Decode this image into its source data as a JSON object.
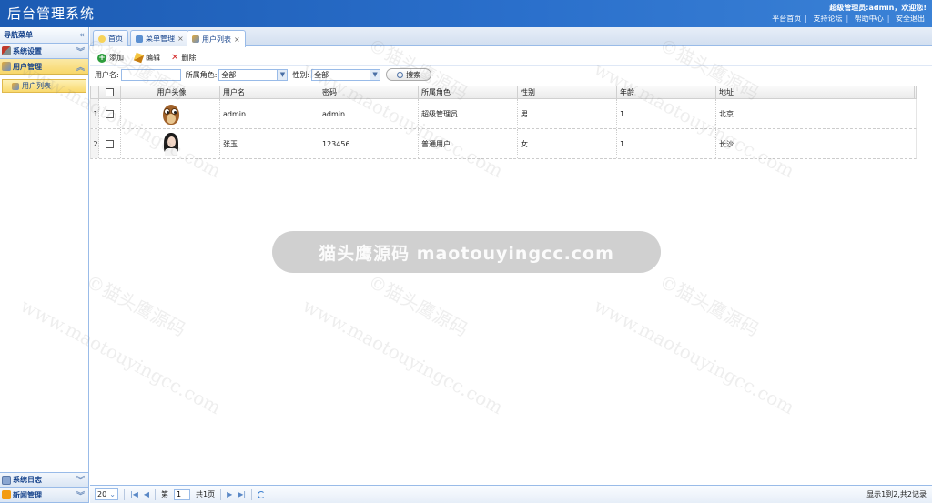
{
  "header": {
    "title": "后台管理系统",
    "welcome": "超级管理员:admin，欢迎您!",
    "links": [
      "平台首页",
      "支持论坛",
      "帮助中心",
      "安全退出"
    ]
  },
  "nav": {
    "title": "导航菜单",
    "panels": [
      {
        "label": "系统设置",
        "icon": "tools-icon"
      },
      {
        "label": "用户管理",
        "icon": "users-icon"
      }
    ],
    "sub_items": [
      {
        "label": "用户列表"
      }
    ],
    "bottom_panels": [
      {
        "label": "系统日志",
        "icon": "log-icon"
      },
      {
        "label": "新闻管理",
        "icon": "rss-icon"
      }
    ]
  },
  "tabs": [
    {
      "label": "首页",
      "closable": false
    },
    {
      "label": "菜单管理",
      "closable": true
    },
    {
      "label": "用户列表",
      "closable": true
    }
  ],
  "toolbar": {
    "add_label": "添加",
    "edit_label": "编辑",
    "delete_label": "删除"
  },
  "search": {
    "username_label": "用户名:",
    "username_value": "",
    "role_label": "所属角色:",
    "role_value": "全部",
    "gender_label": "性别:",
    "gender_value": "全部",
    "button_label": "搜索"
  },
  "table": {
    "columns": [
      "用户头像",
      "用户名",
      "密码",
      "所属角色",
      "性别",
      "年龄",
      "地址"
    ],
    "rows": [
      {
        "num": "1",
        "avatar": "owl-avatar",
        "username": "admin",
        "password": "admin",
        "role": "超级管理员",
        "gender": "男",
        "age": "1",
        "address": "北京"
      },
      {
        "num": "2",
        "avatar": "girl-avatar",
        "username": "张玉",
        "password": "123456",
        "role": "普通用户",
        "gender": "女",
        "age": "1",
        "address": "长沙"
      }
    ]
  },
  "pager": {
    "page_size": "20",
    "page_prefix": "第",
    "page_value": "1",
    "page_suffix": "共1页",
    "info": "显示1到2,共2记录"
  },
  "watermark": {
    "banner": "猫头鹰源码 maotouyingcc.com",
    "lines": [
      "©猫头鹰源码",
      "www.maotouyingcc.com"
    ]
  },
  "colors": {
    "header_bg": "#2a6fcb",
    "active_panel": "#f8d76a",
    "border": "#99bbe8"
  }
}
